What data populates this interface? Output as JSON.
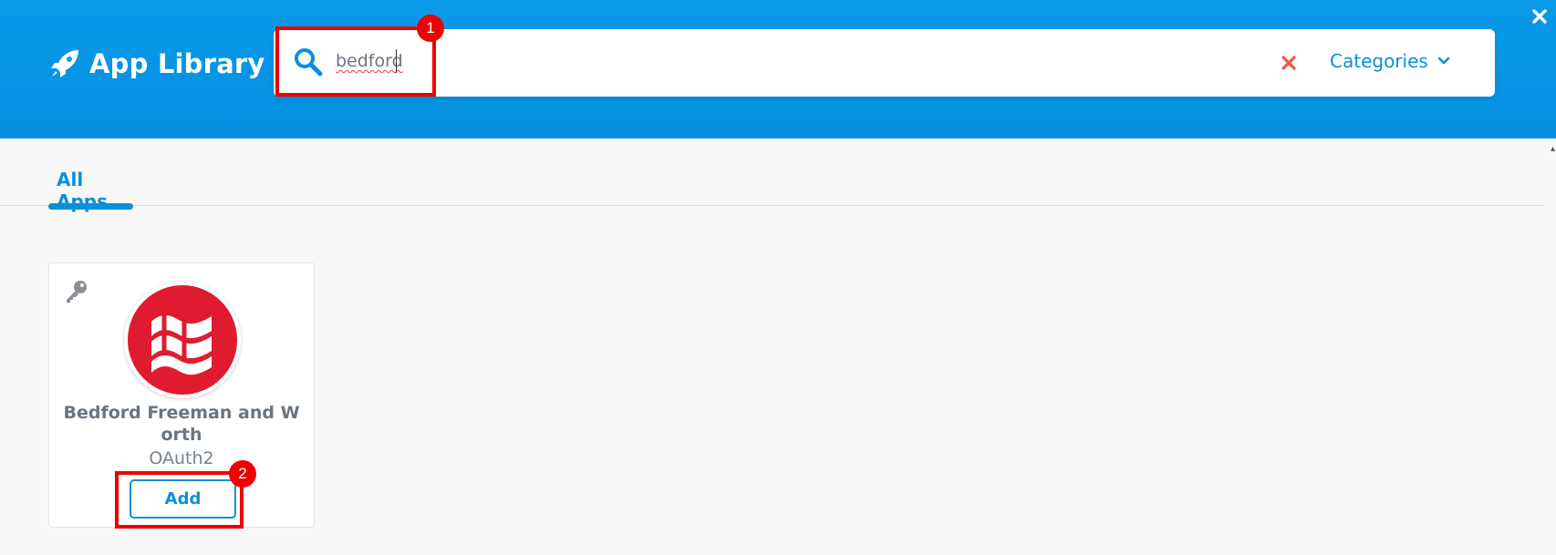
{
  "header": {
    "brand_icon": "rocket-icon",
    "title": "App Library",
    "close_icon": "close-icon"
  },
  "search": {
    "icon": "search-icon",
    "value": "bedford",
    "clear_icon": "clear-x-icon",
    "categories_label": "Categories",
    "categories_icon": "chevron-down-icon"
  },
  "tabs": [
    {
      "label": "All Apps",
      "active": true
    }
  ],
  "apps": [
    {
      "name": "Bedford Freeman and Worth",
      "auth_type": "OAuth2",
      "add_label": "Add",
      "key_icon": "key-icon",
      "logo": "flag-logo"
    }
  ],
  "annotations": [
    {
      "number": "1",
      "target": "search input"
    },
    {
      "number": "2",
      "target": "add button"
    }
  ],
  "colors": {
    "header_blue": "#0a9ae9",
    "accent_blue": "#0a8fdc",
    "clear_red": "#f2554a",
    "logo_red": "#e11b2f",
    "annotation_red": "#ee0000"
  }
}
